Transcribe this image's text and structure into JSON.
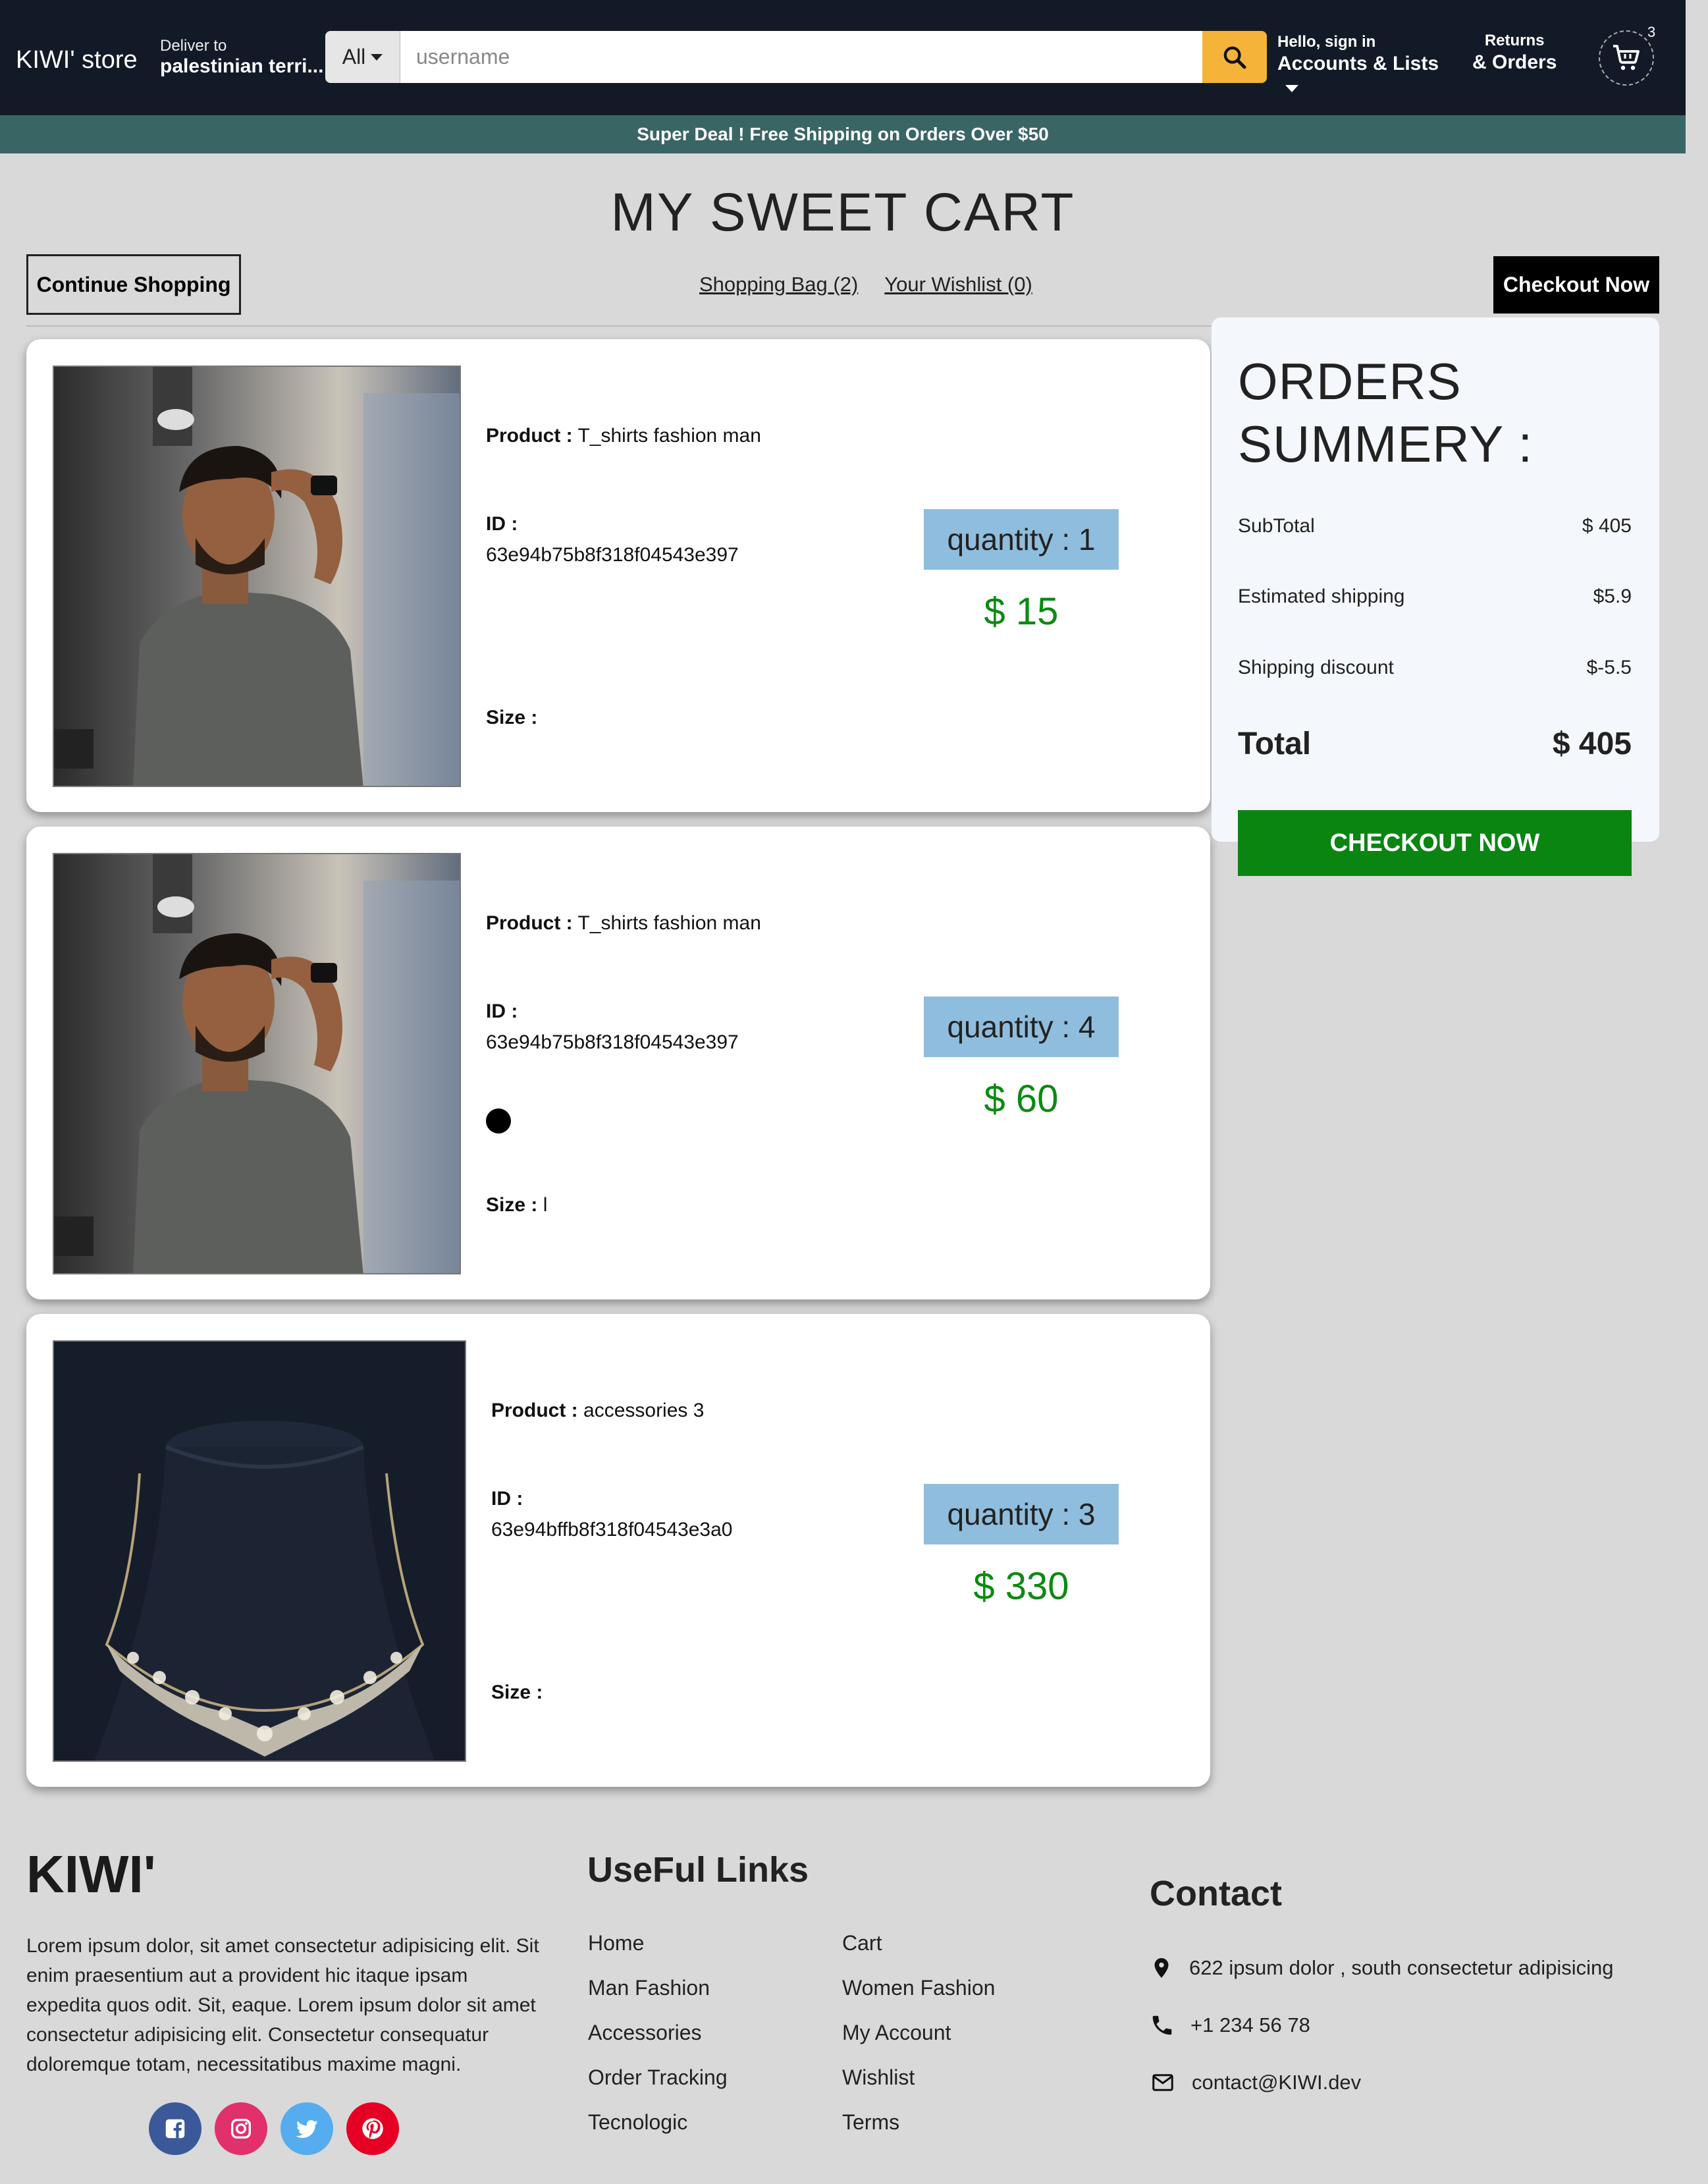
{
  "header": {
    "logo": "KIWI' store",
    "deliver_label": "Deliver to",
    "deliver_location": "palestinian terri...",
    "search_category": "All",
    "search_placeholder": "username",
    "account_greeting": "Hello, sign in",
    "account_label": "Accounts & Lists",
    "returns_label": "Returns",
    "orders_label": "& Orders",
    "cart_count": "3"
  },
  "promo": "Super Deal ! Free Shipping on Orders Over $50",
  "page": {
    "title": "MY SWEET CART",
    "continue_label": "Continue Shopping",
    "shopping_bag": "Shopping Bag (2)",
    "wishlist": "Your Wishlist (0)",
    "checkout_label": "Checkout Now"
  },
  "labels": {
    "product": "Product :",
    "id": "ID :",
    "size": "Size :"
  },
  "items": [
    {
      "name": "T_shirts fashion man",
      "id": "63e94b75b8f318f04543e397",
      "size": "",
      "quantity": "quantity : 1",
      "price": "$ 15"
    },
    {
      "name": "T_shirts fashion man",
      "id": "63e94b75b8f318f04543e397",
      "size": "l",
      "color": "#000000",
      "quantity": "quantity : 4",
      "price": "$ 60"
    },
    {
      "name": "accessories 3",
      "id": "63e94bffb8f318f04543e3a0",
      "size": "",
      "quantity": "quantity : 3",
      "price": "$ 330"
    }
  ],
  "summary": {
    "title_line1": "ORDERS",
    "title_line2": "SUMMERY :",
    "subtotal_label": "SubTotal",
    "subtotal_value": "$ 405",
    "shipping_label": "Estimated shipping",
    "shipping_value": "$5.9",
    "discount_label": "Shipping discount",
    "discount_value": "$-5.5",
    "total_label": "Total",
    "total_value": "$ 405",
    "checkout_label": "CHECKOUT NOW"
  },
  "footer": {
    "brand": "KIWI'",
    "description": "Lorem ipsum dolor, sit amet consectetur adipisicing elit. Sit enim praesentium aut a provident hic itaque ipsam expedita quos odit. Sit, eaque. Lorem ipsum dolor sit amet consectetur adipisicing elit. Consectetur consequatur doloremque totam, necessitatibus maxime magni.",
    "links_title": "UseFul Links",
    "links_left": [
      "Home",
      "Man Fashion",
      "Accessories",
      "Order Tracking",
      "Tecnologic"
    ],
    "links_right": [
      "Cart",
      "Women Fashion",
      "My Account",
      "Wishlist",
      "Terms"
    ],
    "contact_title": "Contact",
    "address": "622 ipsum dolor , south consectetur adipisicing",
    "phone": "+1 234 56 78",
    "email": "contact@KIWI.dev",
    "social": [
      "facebook-icon",
      "instagram-icon",
      "twitter-icon",
      "pinterest-icon"
    ]
  },
  "colors": {
    "header_bg": "#131a27",
    "promo_bg": "#3a6565",
    "search_button": "#f5b33a",
    "quantity_bg": "#8fbddd",
    "price": "#0c8a13",
    "checkout_green": "#0a8512",
    "facebook": "#3b5998",
    "instagram": "#e1306c",
    "twitter": "#55acee",
    "pinterest": "#e60023"
  }
}
